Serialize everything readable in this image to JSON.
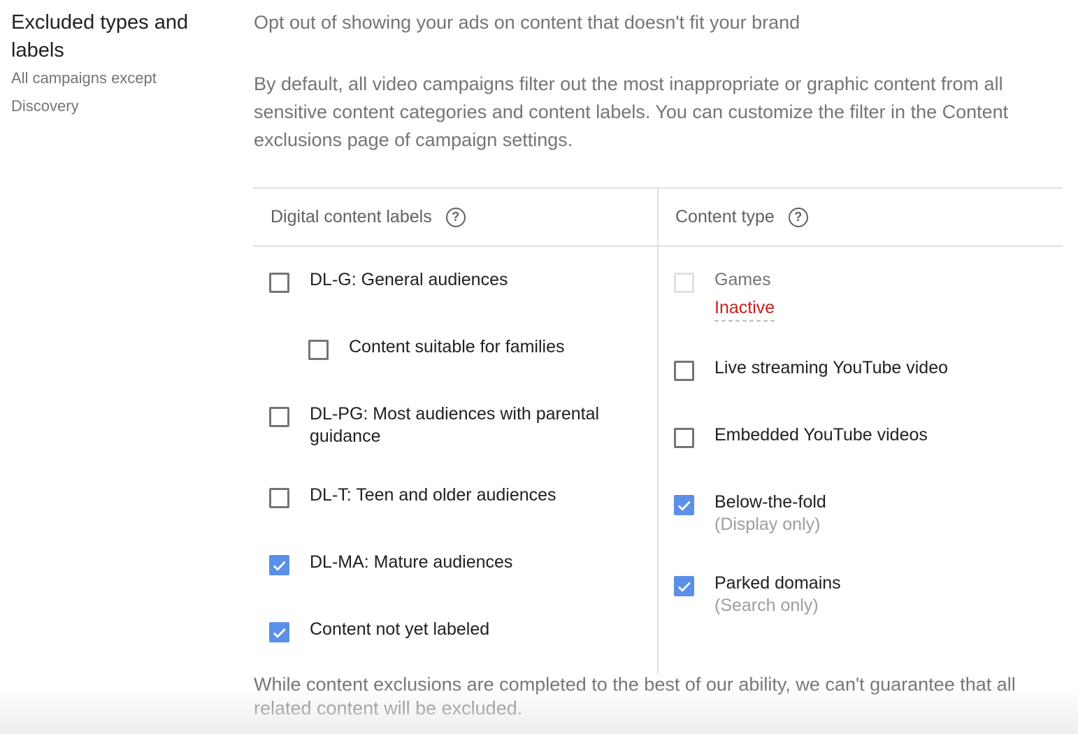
{
  "section": {
    "title": "Excluded types and labels",
    "subtitle": "All campaigns except Discovery"
  },
  "intro": {
    "headline": "Opt out of showing your ads on content that doesn't fit your brand",
    "body": "By default, all video campaigns filter out the most inappropriate or graphic content from all sensitive content categories and content labels. You can customize the filter in the Content exclusions page of campaign settings."
  },
  "digital_labels": {
    "header": "Digital content labels",
    "help_icon": "help-circle-icon",
    "items": [
      {
        "label": "DL-G: General audiences",
        "checked": false
      },
      {
        "label": "Content suitable for families",
        "checked": false
      },
      {
        "label": "DL-PG: Most audiences with parental guidance",
        "checked": false
      },
      {
        "label": "DL-T: Teen and older audiences",
        "checked": false
      },
      {
        "label": "DL-MA: Mature audiences",
        "checked": true
      },
      {
        "label": "Content not yet labeled",
        "checked": true
      }
    ]
  },
  "content_type": {
    "header": "Content type",
    "help_icon": "help-circle-icon",
    "items": [
      {
        "label": "Games",
        "status": "Inactive",
        "checked": false,
        "disabled": true
      },
      {
        "label": "Live streaming YouTube video",
        "checked": false
      },
      {
        "label": "Embedded YouTube videos",
        "checked": false
      },
      {
        "label": "Below-the-fold",
        "note": "(Display only)",
        "checked": true
      },
      {
        "label": "Parked domains",
        "note": "(Search only)",
        "checked": true
      }
    ]
  },
  "disclaimer": "While content exclusions are completed to the best of our ability, we can't guarantee that all related content will be excluded.",
  "colors": {
    "checkbox_checked": "#5b8fe8",
    "inactive_status": "#c5221f"
  }
}
